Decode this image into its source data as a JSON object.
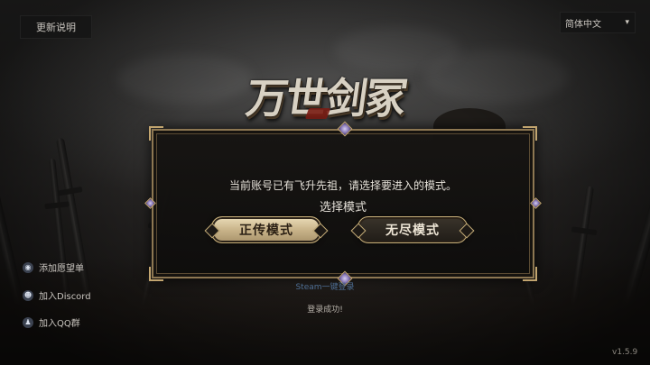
{
  "header": {
    "update_notes_label": "更新说明",
    "language": {
      "selected": "简体中文"
    }
  },
  "logo": {
    "title": "万世剑冢"
  },
  "dialog": {
    "message": "当前账号已有飞升先祖，请选择要进入的模式。",
    "title": "选择模式",
    "buttons": {
      "orthodox_label": "正传模式",
      "endless_label": "无尽模式"
    }
  },
  "status": {
    "steam_login_label": "Steam一键登录",
    "login_success": "登录成功!"
  },
  "social": {
    "wishlist_label": "添加愿望单",
    "discord_label": "加入Discord",
    "qq_label": "加入QQ群"
  },
  "version": "v1.5.9",
  "colors": {
    "frame_gold": "#c2a56f",
    "primary_button": "#d6c39a",
    "steam_link": "#4e6e94"
  },
  "icons": {
    "language_dropdown": "chevron-down-icon",
    "wishlist": "steam-icon",
    "discord": "discord-icon",
    "qq": "qq-icon"
  }
}
